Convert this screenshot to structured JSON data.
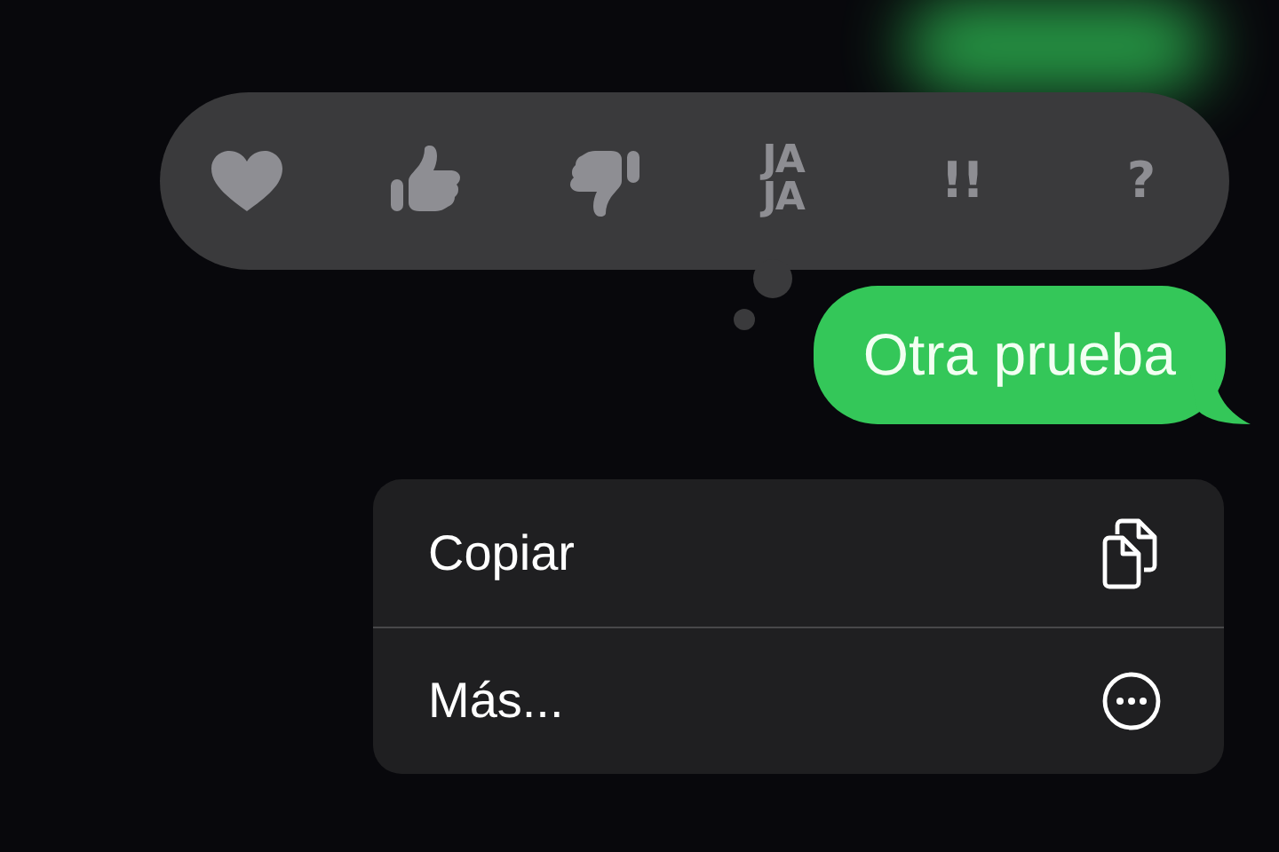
{
  "reactions": [
    {
      "kind": "heart"
    },
    {
      "kind": "thumbs_up"
    },
    {
      "kind": "thumbs_down"
    },
    {
      "kind": "text",
      "lines": [
        "JA",
        "JA"
      ]
    },
    {
      "kind": "text",
      "lines": [
        "!!"
      ]
    },
    {
      "kind": "text",
      "lines": [
        "?"
      ]
    }
  ],
  "message": {
    "text": "Otra prueba"
  },
  "menu": [
    {
      "label": "Copiar",
      "kind": "copy"
    },
    {
      "label": "Más...",
      "kind": "more"
    }
  ]
}
